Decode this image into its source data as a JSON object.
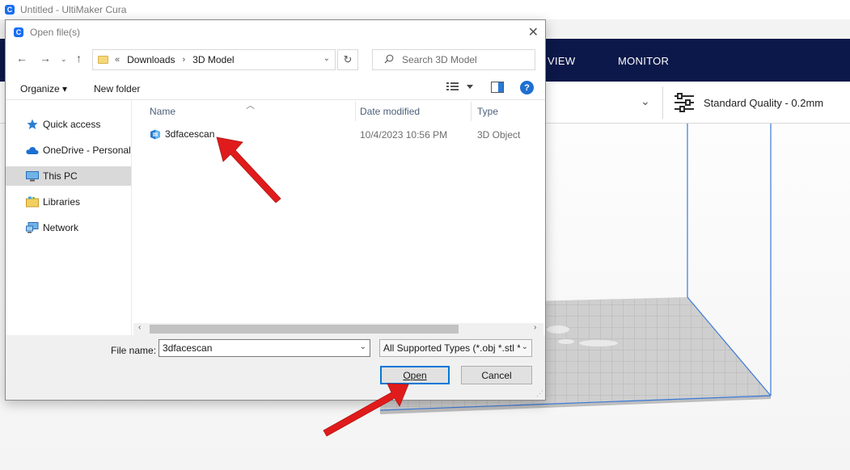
{
  "app": {
    "window_title": "Untitled - UltiMaker Cura",
    "logo_letter": "C",
    "nav": {
      "preview_partial": "VIEW",
      "monitor": "MONITOR"
    },
    "quality_label": "Standard Quality - 0.2mm"
  },
  "dialog": {
    "title": "Open file(s)",
    "breadcrumb": {
      "overflow": "«",
      "items": [
        "Downloads",
        "3D Model"
      ],
      "separator": "›"
    },
    "search_placeholder": "Search 3D Model",
    "toolbar": {
      "organize": "Organize ▾",
      "new_folder": "New folder",
      "help": "?"
    },
    "sidebar": [
      {
        "label": "Quick access",
        "icon": "star-icon"
      },
      {
        "label": "OneDrive - Personal",
        "icon": "cloud-icon"
      },
      {
        "label": "This PC",
        "icon": "computer-icon",
        "selected": true
      },
      {
        "label": "Libraries",
        "icon": "libraries-icon"
      },
      {
        "label": "Network",
        "icon": "network-icon"
      }
    ],
    "columns": {
      "name": "Name",
      "date": "Date modified",
      "type": "Type"
    },
    "files": [
      {
        "name": "3dfacescan",
        "date": "10/4/2023 10:56 PM",
        "type": "3D Object",
        "icon": "3d-object-icon"
      }
    ],
    "file_name_label": "File name:",
    "file_name_value": "3dfacescan",
    "file_type_value": "All Supported Types (*.obj *.stl *",
    "open_button": "Open",
    "cancel_button": "Cancel"
  },
  "colors": {
    "cura_header": "#0b1849",
    "cura_accent": "#196ef0",
    "annotation_arrow": "#e01b1b",
    "selection": "#d9d9d9",
    "primary_border": "#0078d7"
  }
}
